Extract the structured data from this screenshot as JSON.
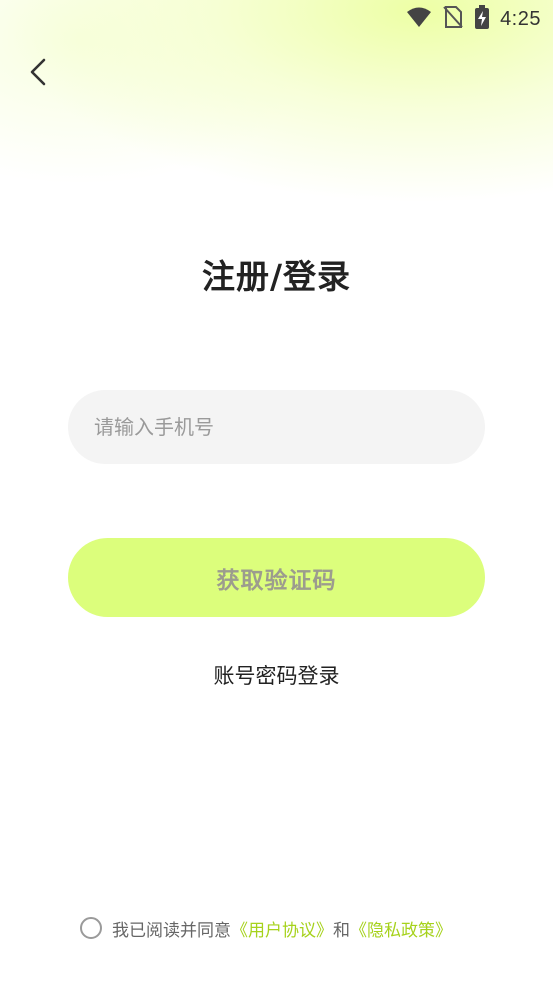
{
  "status_bar": {
    "time": "4:25",
    "icons": [
      "wifi-icon",
      "no-sim-icon",
      "battery-charging-icon"
    ]
  },
  "header": {
    "back_icon": "chevron-left-icon"
  },
  "title": "注册/登录",
  "phone_input": {
    "value": "",
    "placeholder": "请输入手机号"
  },
  "get_code_button": {
    "label": "获取验证码"
  },
  "password_login_link": "账号密码登录",
  "agreement": {
    "prefix": "我已阅读并同意",
    "user_agreement": "《用户协议》",
    "conjunction": "和",
    "privacy_policy": "《隐私政策》"
  },
  "colors": {
    "accent": "#dcfe7c",
    "link": "#a6d21c",
    "input_bg": "#f4f4f4",
    "text_dark": "#222222"
  }
}
